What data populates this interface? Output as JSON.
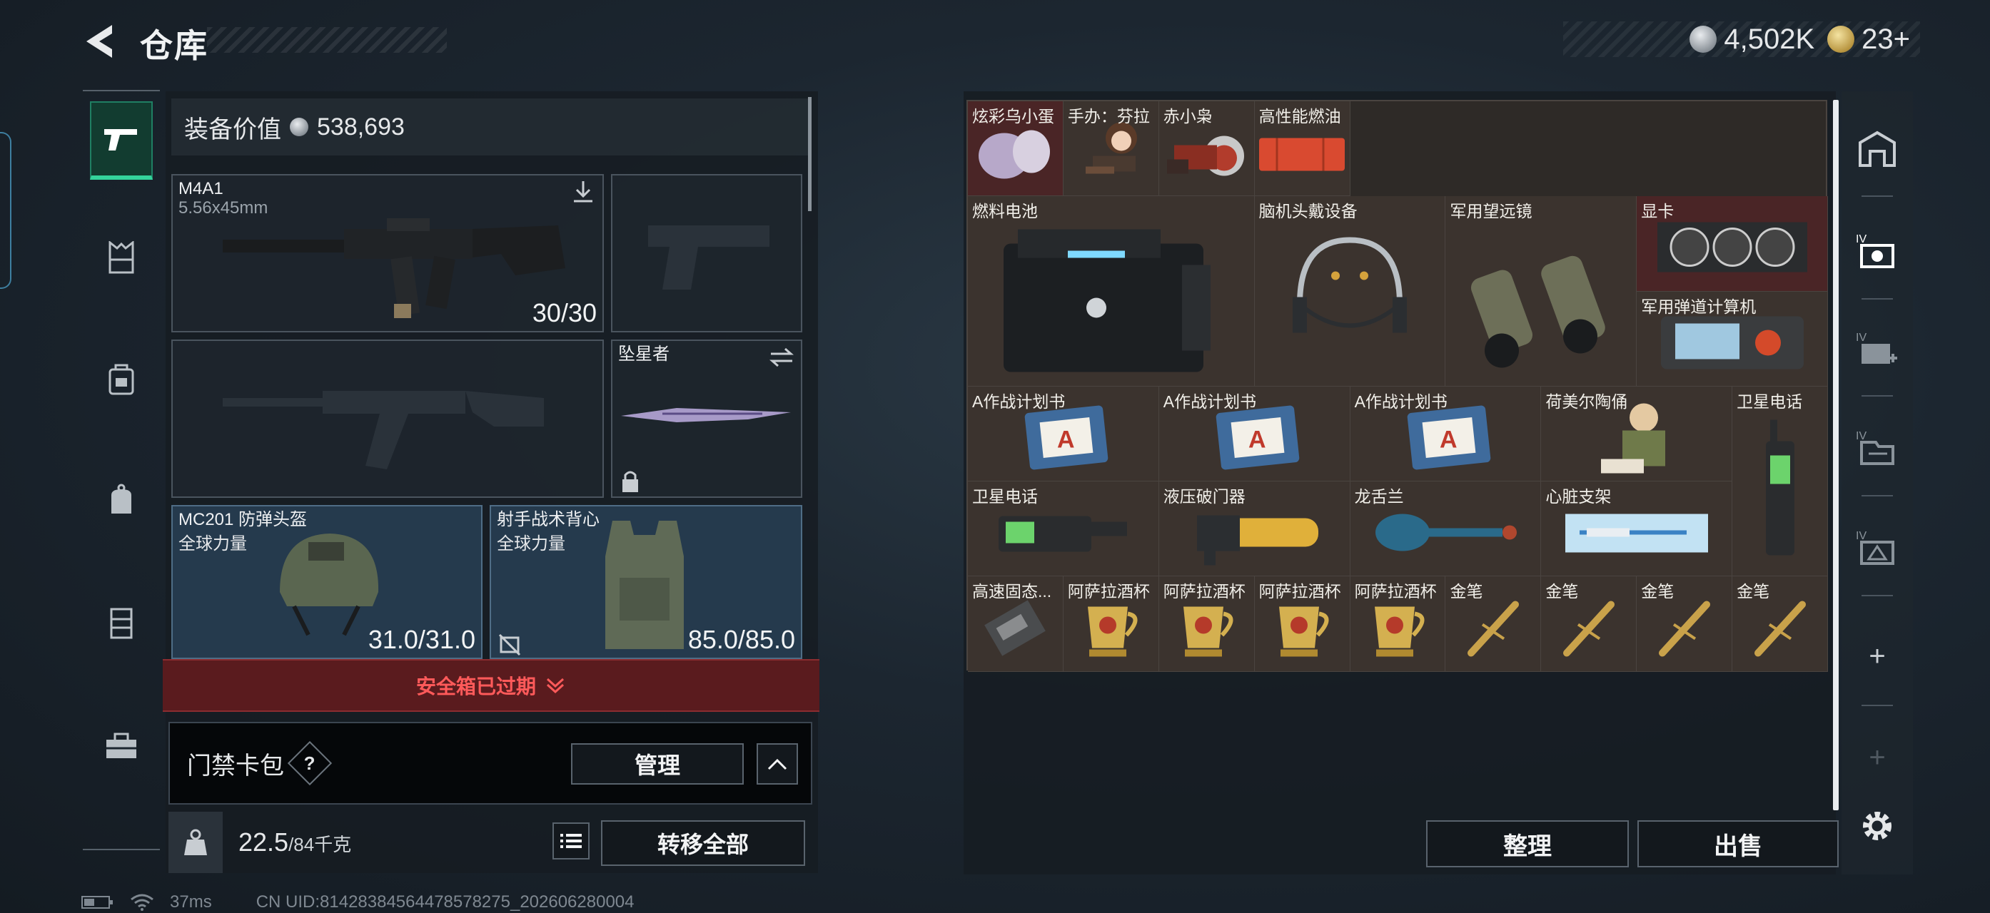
{
  "header": {
    "title": "仓库",
    "currency": [
      {
        "icon": "silver-coin-icon",
        "value": "4,502K"
      },
      {
        "icon": "gold-coin-icon",
        "value": "23+"
      }
    ]
  },
  "left_rail": {
    "items": [
      {
        "name": "weapon-icon",
        "active": true
      },
      {
        "name": "chest-rig-icon"
      },
      {
        "name": "backpack-icon"
      },
      {
        "name": "pouch-icon"
      },
      {
        "name": "cabinet-icon"
      },
      {
        "name": "toolbox-icon"
      }
    ]
  },
  "equipment": {
    "value_label": "装备价值",
    "value": "538,693",
    "primary_weapon": {
      "name": "M4A1",
      "caliber": "5.56x45mm",
      "ammo": "30/30"
    },
    "melee": {
      "name": "坠星者"
    },
    "helmet": {
      "name": "MC201 防弹头盔",
      "sub": "全球力量",
      "durability": "31.0/31.0"
    },
    "armor": {
      "name": "射手战术背心",
      "sub": "全球力量",
      "durability": "85.0/85.0"
    },
    "expired_text": "安全箱已过期",
    "card_pack_label": "门禁卡包",
    "help_text": "?",
    "manage_label": "管理",
    "weight_value": "22.5",
    "weight_max": "/84千克",
    "transfer_all_label": "转移全部"
  },
  "inventory": {
    "items": [
      {
        "label": "炫彩乌小蛋",
        "art": "egg",
        "red": true
      },
      {
        "label": "手办：芬拉",
        "art": "figure"
      },
      {
        "label": "赤小枭",
        "art": "owl"
      },
      {
        "label": "高性能燃油",
        "art": "fuel"
      },
      {
        "label": "燃料电池",
        "art": "battery"
      },
      {
        "label": "脑机头戴设备",
        "art": "headset"
      },
      {
        "label": "军用望远镜",
        "art": "binoculars"
      },
      {
        "label": "显卡",
        "art": "gpu",
        "red": true
      },
      {
        "label": "军用弹道计算机",
        "art": "computer"
      },
      {
        "label": "A作战计划书",
        "art": "book"
      },
      {
        "label": "A作战计划书",
        "art": "book"
      },
      {
        "label": "A作战计划书",
        "art": "book"
      },
      {
        "label": "荷美尔陶俑",
        "art": "figurine"
      },
      {
        "label": "卫星电话",
        "art": "satphone-tall"
      },
      {
        "label": "卫星电话",
        "art": "satphone"
      },
      {
        "label": "液压破门器",
        "art": "breacher"
      },
      {
        "label": "龙舌兰",
        "art": "tequila"
      },
      {
        "label": "心脏支架",
        "art": "stent"
      },
      {
        "label": "高速固态...",
        "art": "ssd"
      },
      {
        "label": "阿萨拉酒杯",
        "art": "cup"
      },
      {
        "label": "阿萨拉酒杯",
        "art": "cup"
      },
      {
        "label": "阿萨拉酒杯",
        "art": "cup"
      },
      {
        "label": "阿萨拉酒杯",
        "art": "cup"
      },
      {
        "label": "金笔",
        "art": "pen"
      },
      {
        "label": "金笔",
        "art": "pen"
      },
      {
        "label": "金笔",
        "art": "pen"
      },
      {
        "label": "金笔",
        "art": "pen"
      }
    ],
    "sort_label": "整理",
    "sell_label": "出售"
  },
  "right_rail": {
    "items": [
      "home-icon",
      "storage-1-icon",
      "storage-2-icon",
      "storage-3-icon",
      "storage-4-icon",
      "add-icon",
      "add-disabled-icon",
      "gear-icon"
    ],
    "add_symbol": "+"
  },
  "status": {
    "ping": "37ms",
    "uid": "CN UID:814283845644785782​75_202606280004"
  },
  "colors": {
    "accent_green": "#34d39b",
    "expired_red": "#ff5a5a",
    "grid_bg": "#3b332e"
  }
}
